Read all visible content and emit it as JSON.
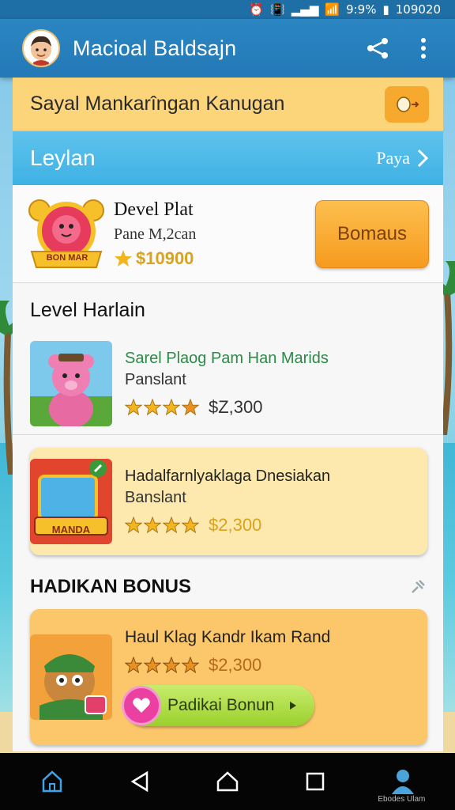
{
  "status_bar": {
    "icons": [
      "alarm-icon",
      "vibrate-icon",
      "signal-icon",
      "wifi-icon",
      "signal-icon",
      "battery-icon"
    ],
    "battery": "9:9%",
    "time": "109020"
  },
  "app_bar": {
    "title": "Macioal Baldsajn",
    "share_icon": "share-icon",
    "menu_icon": "more-vert-icon"
  },
  "promo": {
    "text": "Sayal Mankarîngan Kanugan",
    "button_icon": "coin-arrow-icon"
  },
  "section": {
    "title": "Leylan",
    "link": "Paya"
  },
  "level_card": {
    "title": "Devel Plat",
    "subtitle": "Pane M,2can",
    "points": "$10900",
    "badge_text": "BON MAR",
    "bonus_button": "Bomaus"
  },
  "level_heading": "Level Harlain",
  "games": [
    {
      "title": "Sarel Plaog Pam Han Marids",
      "subtitle": "Panslant",
      "stars": 4,
      "price": "$Z,300"
    },
    {
      "title": "Hadalfarnlyaklaga Dnesiakan",
      "subtitle": "Banslant",
      "stars": 4,
      "price": "$2,300",
      "thumb_text": "MANDA"
    }
  ],
  "bonus_heading": "HADIKAN BONUS",
  "bonus_card": {
    "title": "Haul Klag Kandr Ikam Rand",
    "stars": 4,
    "price": "$2,300",
    "cta": "Padikai Bonun"
  },
  "nav": {
    "items": [
      "home-icon",
      "back-icon",
      "home-circle-icon",
      "recents-icon",
      "profile-icon"
    ],
    "caption": "Ebodes Ulam"
  },
  "colors": {
    "app_bar": "#2379b6",
    "promo": "#fcd57b",
    "section_header": "#3eb2e5",
    "bonus_button": "#f69b1f",
    "star": "#f2b51e",
    "cta": "#9ad12c"
  }
}
